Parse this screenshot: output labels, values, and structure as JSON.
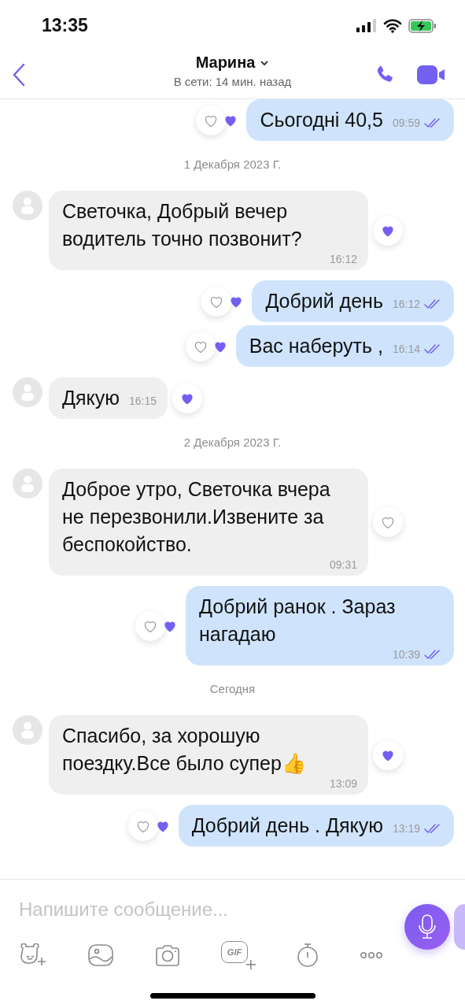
{
  "status_bar": {
    "time": "13:35"
  },
  "header": {
    "contact_name": "Марина",
    "presence": "В сети: 14 мин. назад"
  },
  "messages": [
    {
      "kind": "sent",
      "text": "Сьогодні 40,5",
      "time": "09:59",
      "liked": true,
      "read": true
    },
    {
      "kind": "date",
      "text": "1 Декабря 2023 Г."
    },
    {
      "kind": "received",
      "text": "Светочка, Добрый вечер водитель точно позвонит?",
      "time": "16:12",
      "liked": true
    },
    {
      "kind": "sent",
      "text": "Добрий день",
      "time": "16:12",
      "liked": true,
      "read": true
    },
    {
      "kind": "sent",
      "text": "Вас наберуть ,",
      "time": "16:14",
      "liked": true,
      "read": true
    },
    {
      "kind": "received",
      "text": "Дякую",
      "time": "16:15",
      "liked": true
    },
    {
      "kind": "date",
      "text": "2 Декабря 2023 Г."
    },
    {
      "kind": "received",
      "text": "Доброе утро, Светочка вчера не перезвонили.Извените за беспокойство.",
      "time": "09:31",
      "liked": false
    },
    {
      "kind": "sent",
      "text": "Добрий ранок . Зараз нагадаю",
      "time": "10:39",
      "liked": true,
      "read": true
    },
    {
      "kind": "date",
      "text": "Сегодня"
    },
    {
      "kind": "received",
      "text": "Спасибо, за хорошую поездку.Все было супер👍",
      "time": "13:09",
      "liked": true
    },
    {
      "kind": "sent",
      "text": "Добрий день . Дякую",
      "time": "13:19",
      "liked": true,
      "read": true
    }
  ],
  "composer": {
    "placeholder": "Напишите сообщение...",
    "gif_label": "GIF"
  }
}
